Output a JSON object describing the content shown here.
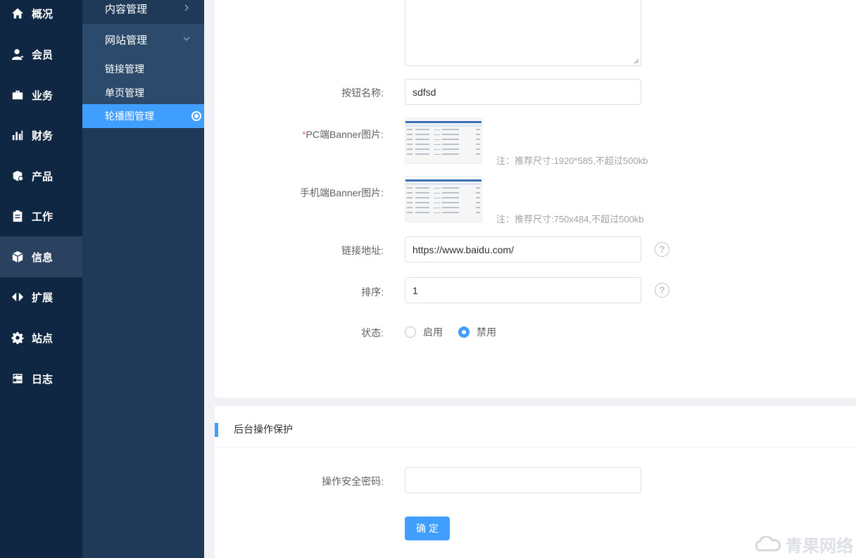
{
  "sidebar": {
    "items": [
      {
        "label": "概况",
        "icon": "home-icon"
      },
      {
        "label": "会员",
        "icon": "user-icon"
      },
      {
        "label": "业务",
        "icon": "briefcase-icon"
      },
      {
        "label": "财务",
        "icon": "bar-chart-icon"
      },
      {
        "label": "产品",
        "icon": "product-box-icon"
      },
      {
        "label": "工作",
        "icon": "clipboard-icon"
      },
      {
        "label": "信息",
        "icon": "cube-icon"
      },
      {
        "label": "扩展",
        "icon": "expand-arrows-icon"
      },
      {
        "label": "站点",
        "icon": "gear-icon"
      },
      {
        "label": "日志",
        "icon": "checklist-icon"
      }
    ],
    "active": "信息"
  },
  "subnav": {
    "groups": [
      {
        "label": "内容管理"
      },
      {
        "label": "网站管理"
      }
    ],
    "subitems": [
      {
        "label": "链接管理"
      },
      {
        "label": "单页管理"
      },
      {
        "label": "轮播图管理"
      }
    ],
    "active": "轮播图管理"
  },
  "form": {
    "button_name": {
      "label": "按钮名称:",
      "value": "sdfsd"
    },
    "pc_banner": {
      "required_mark": "*",
      "label": "PC端Banner图片:",
      "note": "注：推荐尺寸:1920*585,不超过500kb"
    },
    "mobile_banner": {
      "label": "手机端Banner图片:",
      "note": "注：推荐尺寸:750x484,不超过500kb"
    },
    "link": {
      "label": "链接地址:",
      "value": "https://www.baidu.com/"
    },
    "sort": {
      "label": "排序:",
      "value": "1"
    },
    "status": {
      "label": "状态:",
      "options": [
        "启用",
        "禁用"
      ],
      "selected": "禁用"
    }
  },
  "protection": {
    "title": "后台操作保护",
    "password_label": "操作安全密码:",
    "password_value": "",
    "confirm_label": "确定"
  },
  "watermark": {
    "text": "青果网络"
  },
  "colors": {
    "accent": "#409eff",
    "sidebar_bg": "#0f2742",
    "subnav_bg": "#1f3a58"
  }
}
